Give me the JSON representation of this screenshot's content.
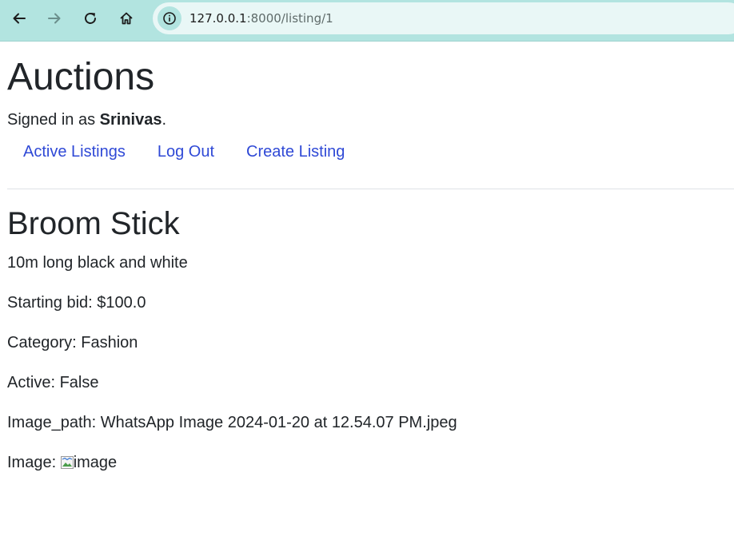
{
  "browser": {
    "url_host": "127.0.0.1",
    "url_rest": ":8000/listing/1"
  },
  "header": {
    "site_title": "Auctions",
    "signed_in_prefix": "Signed in as ",
    "username": "Srinivas",
    "signed_in_suffix": ".",
    "nav": {
      "active_listings": "Active Listings",
      "log_out": "Log Out",
      "create_listing": "Create Listing"
    }
  },
  "listing": {
    "title": "Broom Stick",
    "description": "10m long black and white",
    "starting_bid_label": "Starting bid: ",
    "starting_bid": "$100.0",
    "category_label": "Category: ",
    "category": "Fashion",
    "active_label": "Active: ",
    "active": "False",
    "image_path_label": "Image_path: ",
    "image_path": "WhatsApp Image 2024-01-20 at 12.54.07 PM.jpeg",
    "image_label": "Image: ",
    "image_alt": "image"
  },
  "colors": {
    "browser_bar": "#b2e4e0",
    "link": "#2f49d6",
    "text": "#212529"
  }
}
